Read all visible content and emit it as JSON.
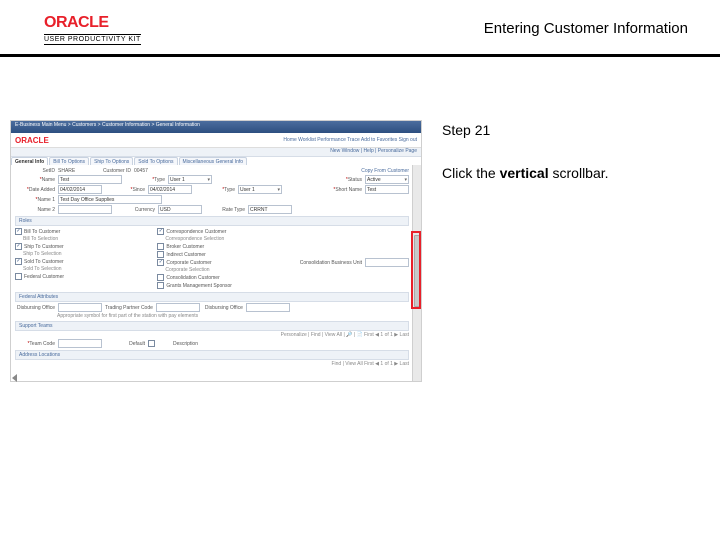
{
  "header": {
    "logo_text": "ORACLE",
    "logo_subtitle": "USER PRODUCTIVITY KIT",
    "page_title": "Entering Customer Information"
  },
  "instructions": {
    "step_label": "Step 21",
    "text_before": "Click the ",
    "text_bold": "vertical",
    "text_after": " scrollbar."
  },
  "screenshot": {
    "breadcrumb": "E-Business    Main Menu >  Customers >  Customer Information >  General Information",
    "brand": "ORACLE",
    "nav_items": "Home    Worklist    Performance Trace    Add to Favorites    Sign out",
    "sub_nav": "New Window | Help | Personalize Page",
    "tabs": [
      "General Info",
      "Bill To Options",
      "Ship To Options",
      "Sold To Options",
      "Miscellaneous General Info"
    ],
    "row1": {
      "setid_label": "SetID",
      "setid_val": "SHARE",
      "custid_label": "Customer ID",
      "custid_val": "00457",
      "copy": "Copy From Customer"
    },
    "row2": {
      "name_label": "Name",
      "name_val": "Test",
      "type_label": "Type",
      "type_val": "User 1",
      "status_label": "Status",
      "status_val": "Active"
    },
    "row3": {
      "d1_label": "Date Added",
      "d1_val": "04/02/2014",
      "since_label": "Since",
      "since_val": "04/02/2014",
      "d2_label": "Type",
      "d2_val": "User 1",
      "short_label": "Short Name",
      "short_val": "Test"
    },
    "row4": {
      "name1_label": "Name 1",
      "name1_val": "Test Day Office Supplies"
    },
    "row5": {
      "name2_label": "Name 2",
      "name2_val": "",
      "cur_label": "Currency",
      "cur_val": "USD",
      "rate_label": "Rate Type",
      "rate_val": "CRRNT"
    },
    "section_roles": "Roles",
    "roles_left": [
      {
        "label": "Bill To Customer",
        "checked": true
      },
      {
        "label": "Bill To Selection",
        "sub": true
      },
      {
        "label": "Ship To Customer",
        "checked": true
      },
      {
        "label": "Ship To Selection",
        "sub": true
      },
      {
        "label": "Sold To Customer",
        "checked": true
      },
      {
        "label": "Sold To Selection",
        "sub": true
      },
      {
        "label": "Federal Customer",
        "checked": false
      }
    ],
    "roles_right": [
      {
        "label": "Correspondence Customer",
        "checked": true
      },
      {
        "label": "Correspondence Selection",
        "sub": true
      },
      {
        "label": "Broker Customer",
        "checked": false
      },
      {
        "label": "Indirect Customer",
        "checked": false
      },
      {
        "label": "Corporate Customer",
        "checked": true
      },
      {
        "label": "Corporate Selection",
        "sub": true
      },
      {
        "label": "Consolidation Customer",
        "checked": false
      },
      {
        "label": "Grants Management Sponsor",
        "checked": false
      }
    ],
    "cons_label": "Consolidation Business Unit",
    "section_federal": "Federal Attributes",
    "fed": {
      "dc_label": "Disbursing Office",
      "tpc_label": "Trading Partner Code",
      "do_label": "Disbursing Office",
      "note": "Appropriate symbol for first part of the station with pay elements"
    },
    "section_support": "Support Teams",
    "support": {
      "tc_label": "Team Code",
      "def_label": "Default",
      "desc_label": "Description",
      "personalize": "Personalize | Find | View All | 🔎 | 📄   First ◀ 1 of 1 ▶ Last"
    },
    "section_address": "Address Locations",
    "addr_footer": "Find | View All    First ◀ 1 of 1 ▶ Last"
  }
}
